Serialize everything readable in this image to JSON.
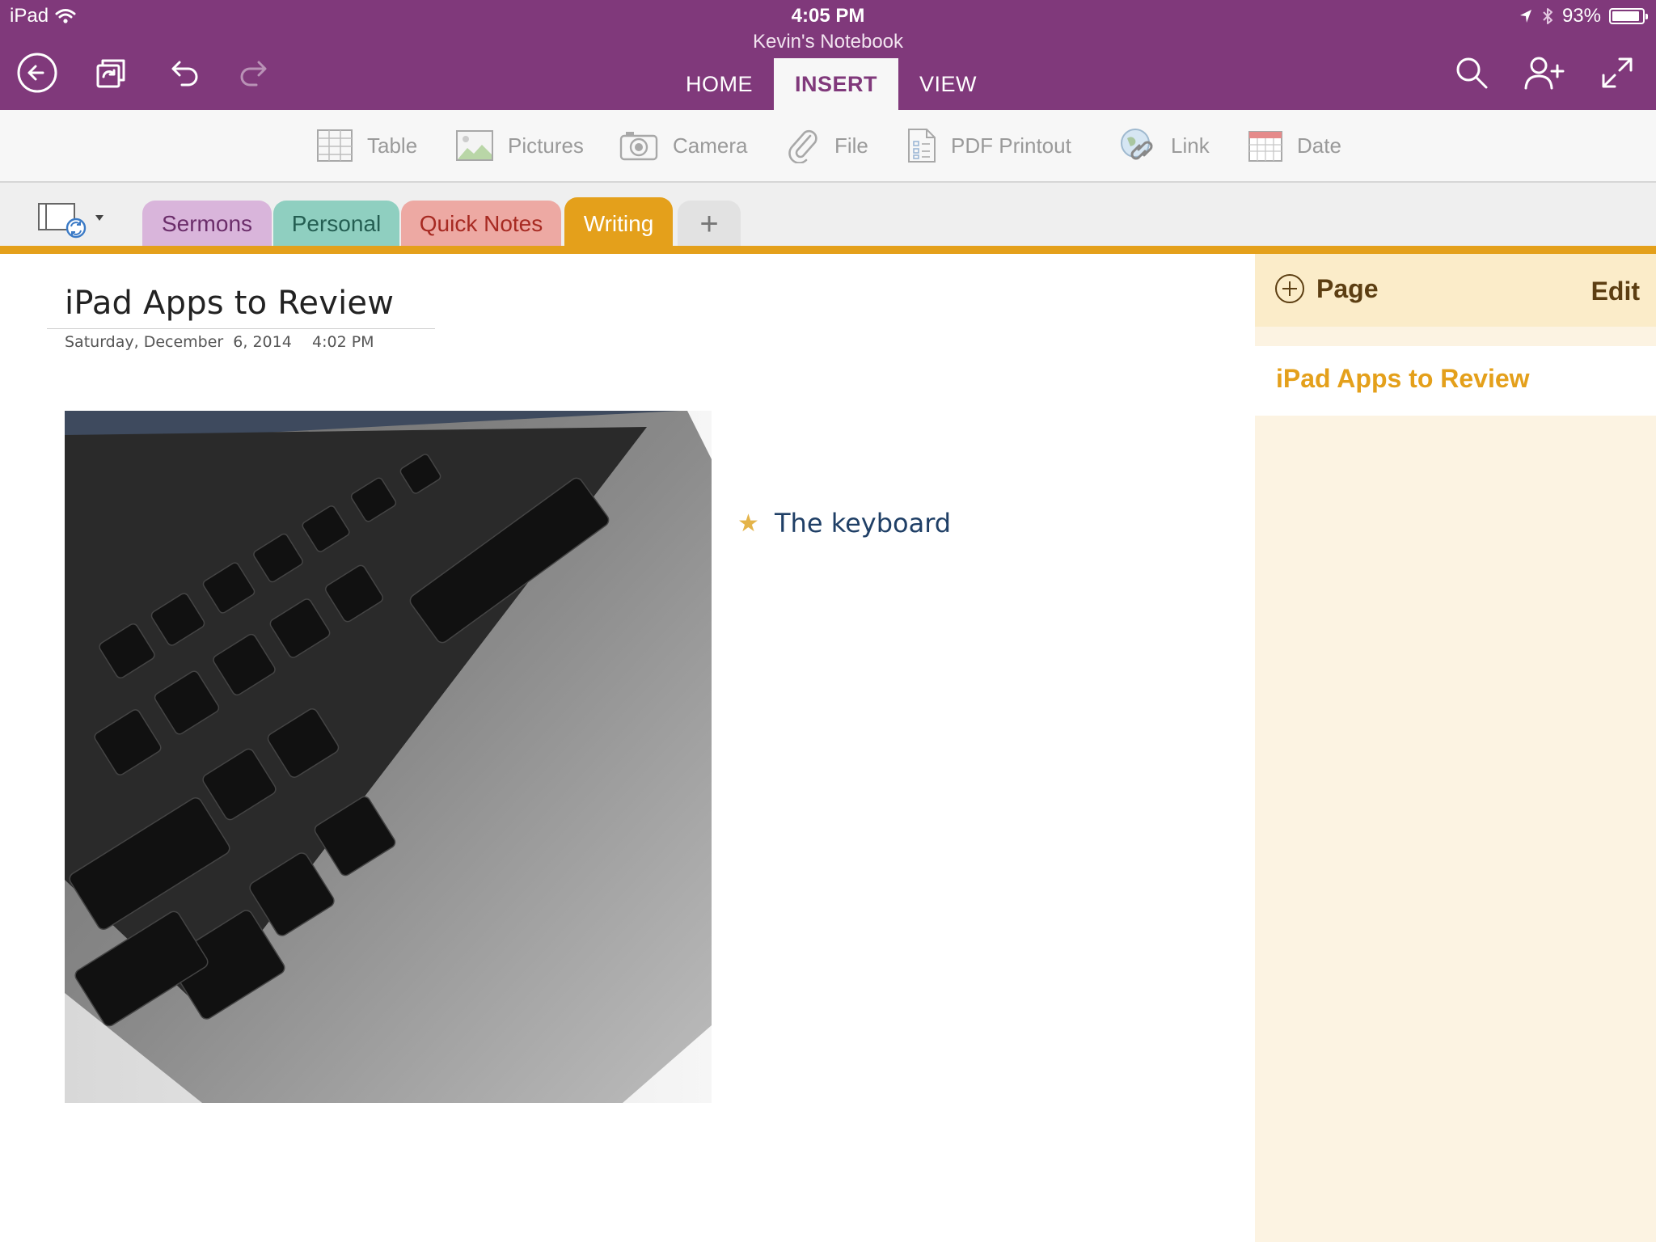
{
  "status_bar": {
    "device": "iPad",
    "time": "4:05 PM",
    "battery": "93%",
    "battery_level": 0.93
  },
  "notebook_title": "Kevin's Notebook",
  "header_icons": [
    "back-icon",
    "sync-icon",
    "undo-icon",
    "redo-icon",
    "search-icon",
    "share-icon",
    "fullscreen-icon"
  ],
  "ribbon_tabs": [
    {
      "label": "HOME",
      "active": false
    },
    {
      "label": "INSERT",
      "active": true
    },
    {
      "label": "VIEW",
      "active": false
    }
  ],
  "toolbar": {
    "table": "Table",
    "pictures": "Pictures",
    "camera": "Camera",
    "file": "File",
    "pdf": "PDF Printout",
    "link": "Link",
    "date": "Date"
  },
  "sections": [
    {
      "label": "Sermons",
      "color": "#D9B5DB"
    },
    {
      "label": "Personal",
      "color": "#8FCFC0"
    },
    {
      "label": "Quick Notes",
      "color": "#EDA9A3"
    },
    {
      "label": "Writing",
      "color": "#E4A01B",
      "active": true
    }
  ],
  "add_section": "+",
  "page": {
    "title": "iPad Apps to Review",
    "date": "Saturday, December  6, 2014",
    "time": "4:02 PM",
    "note": "The keyboard"
  },
  "page_panel": {
    "add_label": "Page",
    "edit_label": "Edit",
    "pages": [
      "iPad Apps to Review"
    ]
  },
  "colors": {
    "header": "#80397B",
    "accent": "#E4A01B"
  }
}
